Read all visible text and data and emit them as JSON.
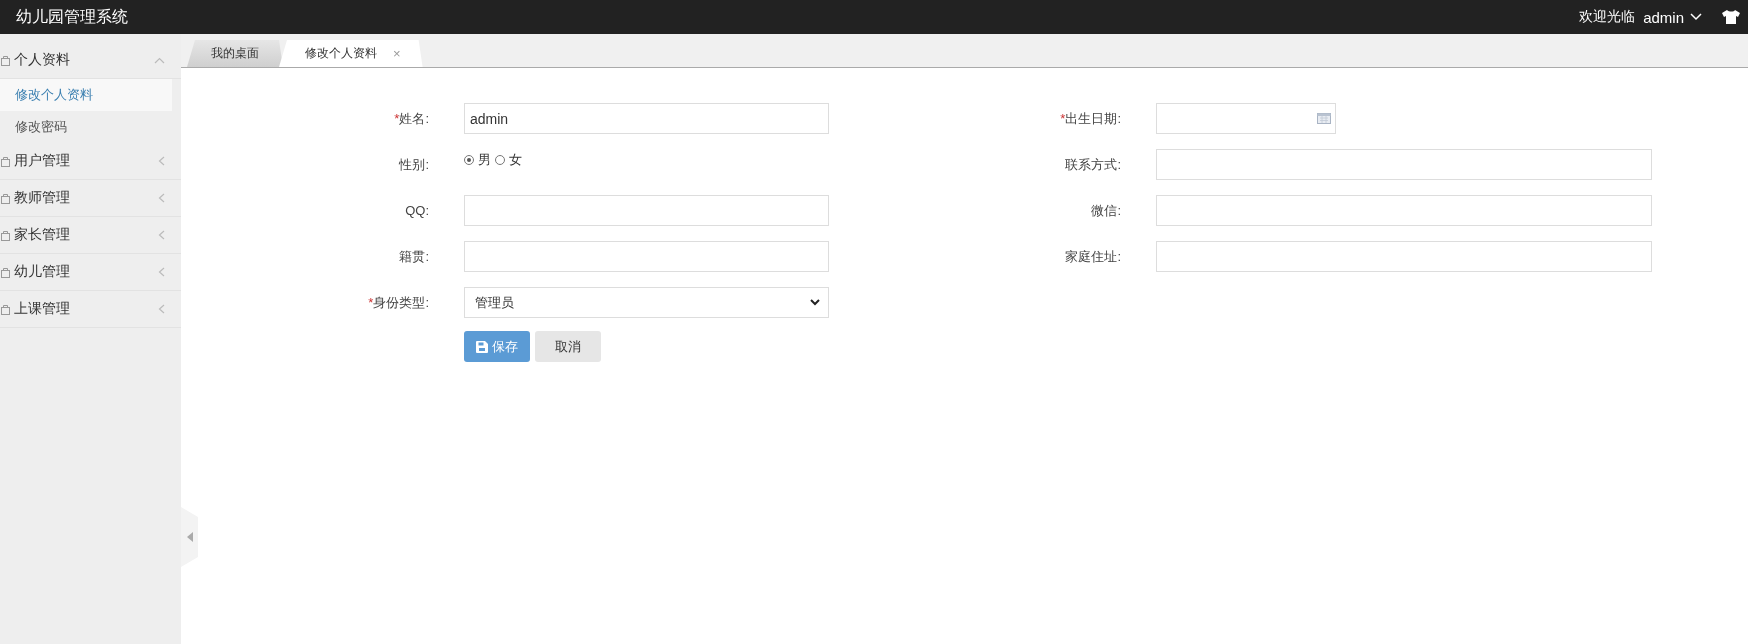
{
  "header": {
    "title": "幼儿园管理系统",
    "welcome": "欢迎光临",
    "user": "admin"
  },
  "sidebar": {
    "groups": [
      {
        "label": "个人资料",
        "expanded": true,
        "children": [
          {
            "label": "修改个人资料",
            "selected": true
          },
          {
            "label": "修改密码",
            "selected": false
          }
        ]
      },
      {
        "label": "用户管理",
        "expanded": false
      },
      {
        "label": "教师管理",
        "expanded": false
      },
      {
        "label": "家长管理",
        "expanded": false
      },
      {
        "label": "幼儿管理",
        "expanded": false
      },
      {
        "label": "上课管理",
        "expanded": false
      }
    ]
  },
  "tabs": [
    {
      "label": "我的桌面",
      "selected": false
    },
    {
      "label": "修改个人资料",
      "selected": true,
      "close": "×"
    }
  ],
  "form": {
    "fields": [
      {
        "kind": "text",
        "mark": "*",
        "label": "姓名:",
        "value": "admin"
      },
      {
        "kind": "date",
        "mark": "*",
        "label": "出生日期:"
      },
      {
        "kind": "radio",
        "label": "性别:",
        "options": [
          {
            "label": "男",
            "selected": true
          },
          {
            "label": "女",
            "selected": false
          }
        ]
      },
      {
        "kind": "text",
        "label": "联系方式:"
      },
      {
        "kind": "text",
        "label": "QQ:"
      },
      {
        "kind": "text",
        "label": "微信:"
      },
      {
        "kind": "text",
        "label": "籍贯:"
      },
      {
        "kind": "text",
        "label": "家庭住址:"
      },
      {
        "kind": "select",
        "mark": "*",
        "label": "身份类型:",
        "value": "管理员"
      }
    ],
    "buttons": [
      {
        "label": "保存",
        "kind": "primary"
      },
      {
        "label": "取消",
        "kind": "default"
      }
    ]
  }
}
